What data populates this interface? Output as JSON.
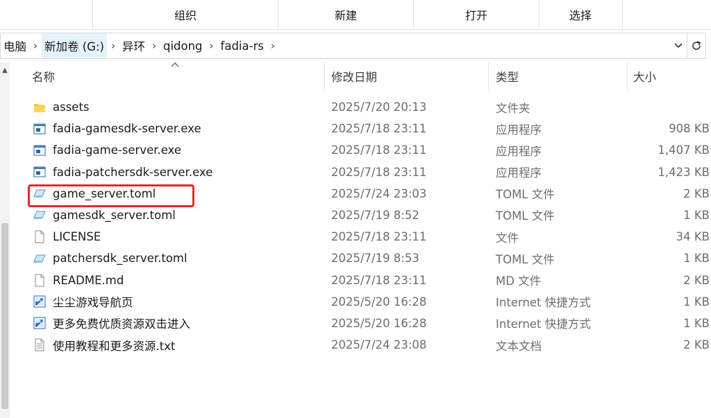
{
  "ribbon": {
    "groups": [
      "组织",
      "新建",
      "打开",
      "选择"
    ]
  },
  "address_bar": {
    "crumbs": [
      "电脑",
      "新加卷 (G:)",
      "异环",
      "qidong",
      "fadia-rs"
    ],
    "separator": "›",
    "dropdown_icon": "chevron-down-icon",
    "refresh_icon": "refresh-icon"
  },
  "columns": {
    "name": "名称",
    "date": "修改日期",
    "type": "类型",
    "size": "大小"
  },
  "files": [
    {
      "name": "assets",
      "date": "2025/7/20 20:13",
      "type": "文件夹",
      "size": "",
      "icon": "folder-icon"
    },
    {
      "name": "fadia-gamesdk-server.exe",
      "date": "2025/7/18 23:11",
      "type": "应用程序",
      "size": "908 KB",
      "icon": "exe-icon"
    },
    {
      "name": "fadia-game-server.exe",
      "date": "2025/7/18 23:11",
      "type": "应用程序",
      "size": "1,407 KB",
      "icon": "exe-icon"
    },
    {
      "name": "fadia-patchersdk-server.exe",
      "date": "2025/7/18 23:11",
      "type": "应用程序",
      "size": "1,423 KB",
      "icon": "exe-icon"
    },
    {
      "name": "game_server.toml",
      "date": "2025/7/24 23:03",
      "type": "TOML 文件",
      "size": "2 KB",
      "icon": "toml-file-icon"
    },
    {
      "name": "gamesdk_server.toml",
      "date": "2025/7/19 8:52",
      "type": "TOML 文件",
      "size": "1 KB",
      "icon": "toml-file-icon"
    },
    {
      "name": "LICENSE",
      "date": "2025/7/18 23:11",
      "type": "文件",
      "size": "34 KB",
      "icon": "blank-file-icon"
    },
    {
      "name": "patchersdk_server.toml",
      "date": "2025/7/19 8:53",
      "type": "TOML 文件",
      "size": "1 KB",
      "icon": "toml-file-icon"
    },
    {
      "name": "README.md",
      "date": "2025/7/18 23:11",
      "type": "MD 文件",
      "size": "2 KB",
      "icon": "blank-file-icon"
    },
    {
      "name": "尘尘游戏导航页",
      "date": "2025/5/20 16:28",
      "type": "Internet 快捷方式",
      "size": "1 KB",
      "icon": "internet-shortcut-icon"
    },
    {
      "name": "更多免费优质资源双击进入",
      "date": "2025/5/20 16:28",
      "type": "Internet 快捷方式",
      "size": "1 KB",
      "icon": "internet-shortcut-icon"
    },
    {
      "name": "使用教程和更多资源.txt",
      "date": "2025/7/24 23:08",
      "type": "文本文档",
      "size": "2 KB",
      "icon": "text-file-icon"
    }
  ],
  "colors": {
    "highlight_box": "#e8262d",
    "breadcrumb_hover": "#e5f3fb"
  }
}
